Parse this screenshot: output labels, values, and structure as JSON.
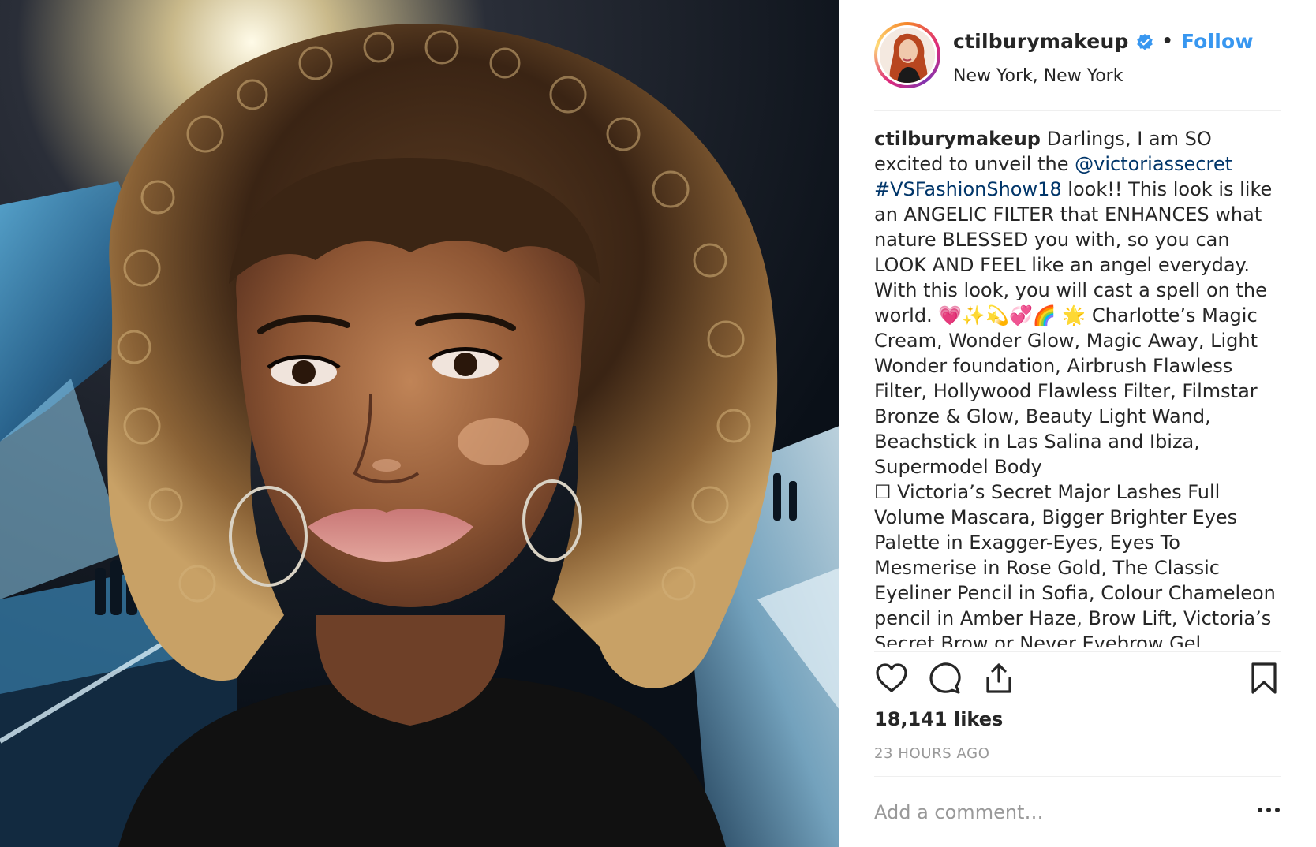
{
  "post": {
    "username": "ctilburymakeup",
    "follow_label": "Follow",
    "separator": "•",
    "location": "New York, New York"
  },
  "caption": {
    "username": "ctilburymakeup",
    "part1": " Darlings, I am SO excited to unveil the ",
    "mention": "@victoriassecret",
    "space": " ",
    "hashtag": "#VSFashionShow18",
    "part2": " look!! This look is like an ANGELIC FILTER that ENHANCES what nature BLESSED you with, so you can LOOK AND FEEL like an angel everyday. With this look, you will cast a spell on the world. 💗✨💫💞🌈 🌟 Charlotte’s Magic Cream, Wonder Glow, Magic Away, Light Wonder foundation, Airbrush Flawless Filter, Hollywood Flawless Filter, Filmstar Bronze & Glow, Beauty Light Wand, Beachstick in Las Salina and Ibiza, Supermodel Body",
    "part3": "☐ Victoria’s Secret Major Lashes Full Volume Mascara, Bigger Brighter Eyes Palette in Exagger-Eyes, Eyes To Mesmerise in Rose Gold, The Classic Eyeliner Pencil in Sofia, Colour Chameleon pencil in Amber Haze, Brow Lift, Victoria’s Secret Brow or Never Eyebrow Gel"
  },
  "stats": {
    "likes": "18,141 likes",
    "time": "23 HOURS AGO"
  },
  "comment": {
    "placeholder": "Add a comment…"
  },
  "colors": {
    "accent": "#3897f0",
    "link": "#003569",
    "muted": "#999999",
    "text": "#262626"
  },
  "icons": [
    "verified-badge-icon",
    "heart-icon",
    "comment-icon",
    "share-icon",
    "bookmark-icon",
    "more-options-icon"
  ]
}
